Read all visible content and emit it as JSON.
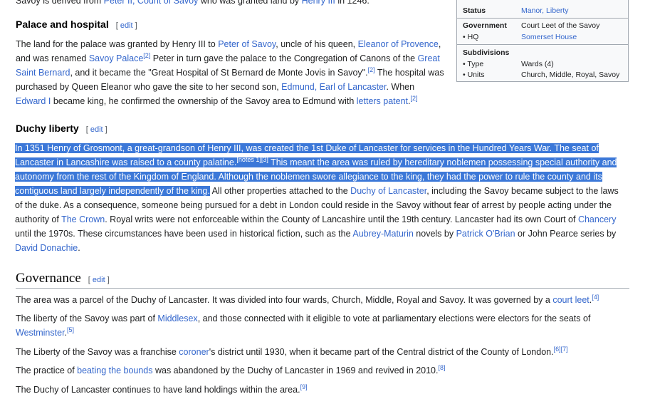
{
  "top_line": {
    "pre": "Savoy is derived from ",
    "link1": "Peter II, Count of Savoy",
    "mid": " who was granted land by ",
    "link2": "Henry III",
    "post": " in 1246."
  },
  "infobox": {
    "status_label": "Status",
    "status_value": "Manor, Liberty",
    "government_label": "Government",
    "government_value": "Court Leet of the Savoy",
    "hq_label": "• HQ",
    "hq_value": "Somerset House",
    "subdivisions_label": "Subdivisions",
    "type_label": "• Type",
    "type_value": "Wards (4)",
    "units_label": "• Units",
    "units_value": "Church, Middle, Royal, Savoy"
  },
  "palace": {
    "heading": "Palace and hospital",
    "edit": "edit",
    "t1": "The land for the palace was granted by Henry III to ",
    "l1": "Peter of Savoy",
    "t2": ", uncle of his queen, ",
    "l2": "Eleanor of Provence",
    "t3": ",",
    "t4": "and was renamed ",
    "l3": "Savoy Palace",
    "r1": "[2]",
    "t5": " Peter in turn gave the palace to the Congregation of Canons of the ",
    "l4a": "Great",
    "l4b": "Saint Bernard",
    "t6": ", and it became the \"Great Hospital of St Bernard de Monte Jovis in Savoy\".",
    "r2": "[2]",
    "t7": " The hospital was",
    "t8": "purchased by Queen Eleanor who gave the site to her second son, ",
    "l5": "Edmund, Earl of Lancaster",
    "t9": ". When",
    "l6": "Edward I",
    "t10": " became king, he confirmed the ownership of the Savoy area to Edmund with ",
    "l7": "letters patent",
    "t11": ".",
    "r3": "[2]"
  },
  "duchy": {
    "heading": "Duchy liberty",
    "edit": "edit",
    "h1": "In 1351 Henry of Grosmont, a great-grandson of Henry III, was created the 1st Duke of Lancaster for services in the Hundred Years War. The seat of",
    "h2": "Lancaster in Lancashire was raised to a county palatine.",
    "h2sup": "[notes 1][3]",
    "h2b": " This meant the area was ruled by hereditary noblemen possessing special authority and",
    "h3": "autonomy from the rest of the Kingdom of England. Although the noblemen swore allegiance to the king, they had the power to rule the county and its",
    "h4": "contiguous land largely independently of the king.",
    "t1": " All other properties attached to the ",
    "l1": "Duchy of Lancaster",
    "t2": ", including the Savoy became subject to the laws",
    "t3": "of the duke. As a consequence, someone being pursued for a debt in London could reside in the Savoy without fear of arrest by people acting under the",
    "t4": "authority of ",
    "l2": "The Crown",
    "t5": ". Royal writs were not enforceable within the County of Lancashire until the 19th century. Lancaster had its own Court of ",
    "l3": "Chancery",
    "t6": "until the 1970s. These circumstances have been used in historical fiction, such as the ",
    "l4": "Aubrey-Maturin",
    "t7": " novels by ",
    "l5": "Patrick O'Brian",
    "t8": " or John Pearce series by",
    "l6": "David Donachie",
    "t9": "."
  },
  "governance": {
    "heading": "Governance",
    "edit": "edit",
    "p1a": "The area was a parcel of the Duchy of Lancaster. It was divided into four wards, Church, Middle, Royal and Savoy. It was governed by a ",
    "p1l": "court leet",
    "p1b": ".",
    "p1r": "[4]",
    "p2a": "The liberty of the Savoy was part of ",
    "p2l": "Middlesex",
    "p2b": ", and those connected with it eligible to vote at parliamentary elections were electors for the seats of",
    "p2l2": "Westminster",
    "p2c": ".",
    "p2r": "[5]",
    "p3a": "The Liberty of the Savoy was a franchise ",
    "p3l": "coroner",
    "p3b": "'s district until 1930, when it became part of the Central district of the County of London.",
    "p3r": "[6][7]",
    "p4a": "The practice of ",
    "p4l": "beating the bounds",
    "p4b": " was abandoned by the Duchy of Lancaster in 1969 and revived in 2010.",
    "p4r": "[8]",
    "p5a": "The Duchy of Lancaster continues to have land holdings within the area.",
    "p5r": "[9]"
  }
}
